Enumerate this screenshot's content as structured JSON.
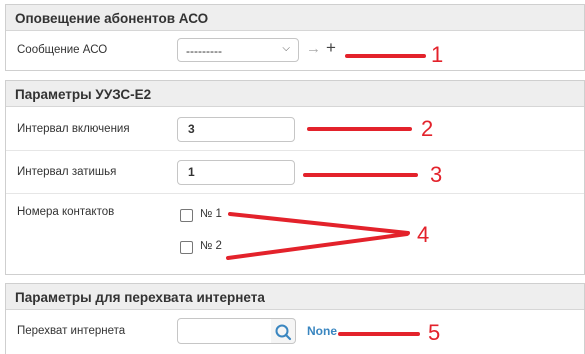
{
  "sections": {
    "aso": {
      "title": "Оповещение абонентов АСО",
      "message_label": "Сообщение АСО",
      "message_value": "---------",
      "arrow_glyph": "→",
      "add_glyph": "+"
    },
    "uzs": {
      "title": "Параметры УУЗС-Е2",
      "interval_on_label": "Интервал включения",
      "interval_on_value": "3",
      "interval_quiet_label": "Интервал затишья",
      "interval_quiet_value": "1",
      "contacts_label": "Номера контактов",
      "contacts": [
        {
          "label": "№ 1",
          "checked": false
        },
        {
          "label": "№ 2",
          "checked": false
        }
      ]
    },
    "internet": {
      "title": "Параметры для перехвата интернета",
      "intercept_label": "Перехват интернета",
      "intercept_value": "",
      "none_link": "None"
    }
  },
  "annotations": {
    "numbers": [
      "1",
      "2",
      "3",
      "4",
      "5"
    ],
    "color": "#e3222b"
  },
  "colors": {
    "header_bg": "#eeeeee",
    "link": "#3a86c0"
  }
}
